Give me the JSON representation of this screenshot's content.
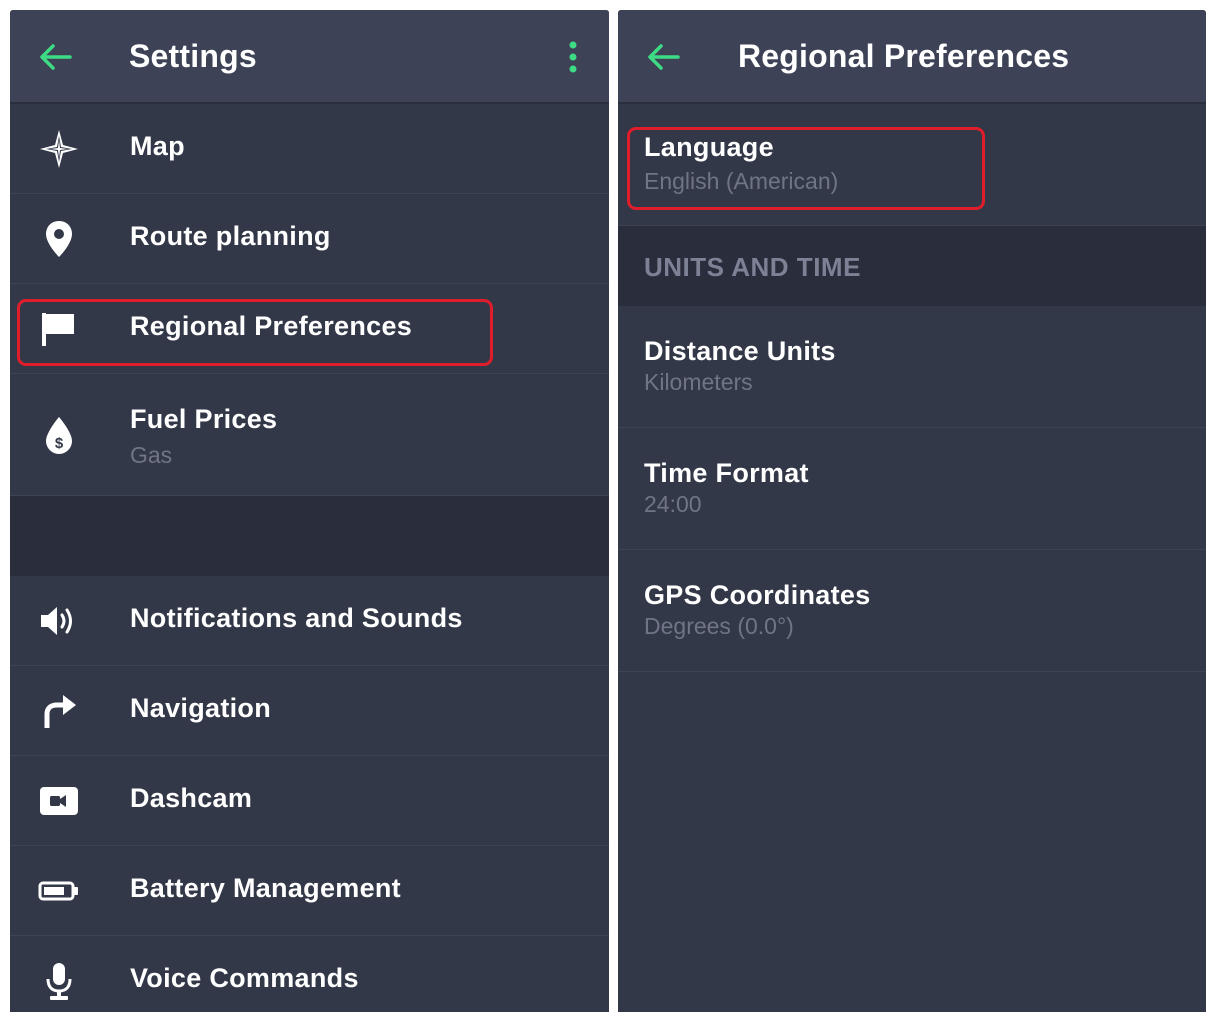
{
  "colors": {
    "background": "#333848",
    "topbar": "#3d4256",
    "accent_green": "#3ddc84",
    "highlight_red": "#e01d2a",
    "subtext": "#6f7487"
  },
  "settings": {
    "title": "Settings",
    "back_icon": "arrow-left-icon",
    "more_icon": "more-vertical-icon",
    "items_top": [
      {
        "label": "Map",
        "icon": "compass-star-icon"
      },
      {
        "label": "Route planning",
        "icon": "location-pin-icon"
      },
      {
        "label": "Regional Preferences",
        "icon": "flag-icon"
      },
      {
        "label": "Fuel Prices",
        "sub": "Gas",
        "icon": "fuel-drop-icon"
      }
    ],
    "items_bottom": [
      {
        "label": "Notifications and Sounds",
        "icon": "speaker-icon"
      },
      {
        "label": "Navigation",
        "icon": "turn-right-arrow-icon"
      },
      {
        "label": "Dashcam",
        "icon": "video-camera-icon"
      },
      {
        "label": "Battery Management",
        "icon": "battery-icon"
      },
      {
        "label": "Voice Commands",
        "icon": "microphone-icon"
      }
    ]
  },
  "regional": {
    "title": "Regional Preferences",
    "back_icon": "arrow-left-icon",
    "language": {
      "label": "Language",
      "value": "English (American)"
    },
    "section_header": "UNITS AND TIME",
    "distance_units": {
      "label": "Distance Units",
      "value": "Kilometers"
    },
    "time_format": {
      "label": "Time Format",
      "value": "24:00"
    },
    "gps_coordinates": {
      "label": "GPS Coordinates",
      "value": "Degrees (0.0°)"
    }
  }
}
